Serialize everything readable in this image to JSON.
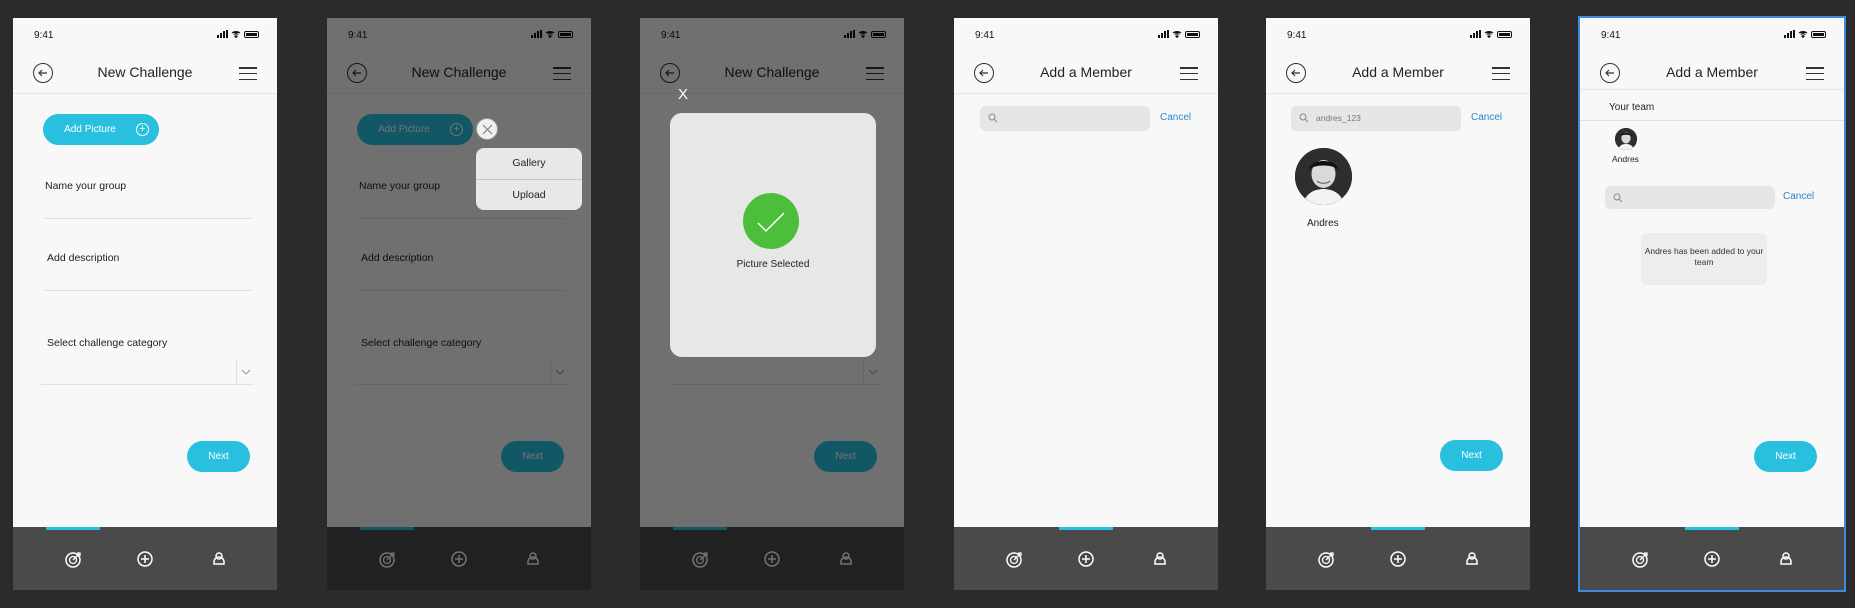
{
  "status": {
    "time": "9:41"
  },
  "screens": {
    "create": {
      "title": "New Challenge",
      "add_picture": "Add Picture",
      "name_label": "Name your group",
      "description_label": "Add description",
      "category_label": "Select challenge category",
      "next_label": "Next"
    },
    "picture_menu": {
      "gallery": "Gallery",
      "upload": "Upload"
    },
    "picture_selected": {
      "close": "X",
      "message": "Picture Selected"
    },
    "add_member": {
      "title": "Add a Member",
      "search_placeholder": "",
      "search_query": "andres_123",
      "cancel_label": "Cancel",
      "result_name": "Andres",
      "next_label": "Next"
    },
    "team": {
      "section_label": "Your team",
      "member_name": "Andres",
      "toast": "Andres has been added to your team"
    }
  },
  "tabbar": {
    "icons": [
      "target-icon",
      "plus-circle-icon",
      "profile-icon"
    ],
    "accent": "#29c0df"
  },
  "colors": {
    "accent": "#29c0df",
    "success": "#4bbe3a",
    "link": "#2a87c2",
    "tabbar": "#4a4a4a"
  }
}
